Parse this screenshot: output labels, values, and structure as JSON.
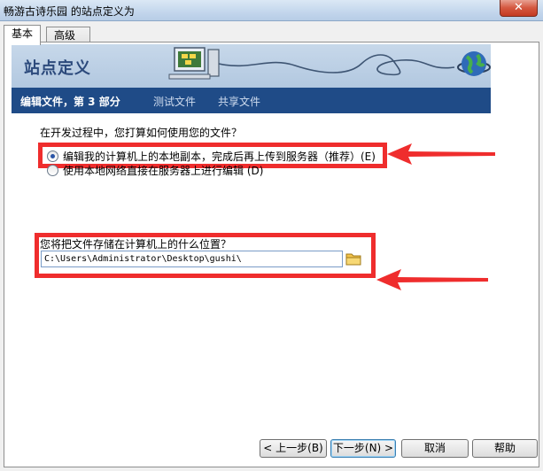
{
  "window": {
    "title": "畅游古诗乐园 的站点定义为",
    "close_label": "✕"
  },
  "tabs": [
    {
      "label": "基本"
    },
    {
      "label": "高级"
    }
  ],
  "banner": {
    "title": "站点定义"
  },
  "wizard_nav": {
    "current": "编辑文件，第 3 部分",
    "test": "测试文件",
    "share": "共享文件"
  },
  "question1": {
    "text": "在开发过程中，您打算如何使用您的文件？",
    "options": [
      {
        "label": "编辑我的计算机上的本地副本，完成后再上传到服务器（推荐）(E)",
        "selected": true
      },
      {
        "label": "使用本地网络直接在服务器上进行编辑 (D)",
        "selected": false
      }
    ]
  },
  "question2": {
    "text": "您将把文件存储在计算机上的什么位置？",
    "path_value": "C:\\Users\\Administrator\\Desktop\\gushi\\"
  },
  "buttons": {
    "back": "< 上一步(B)",
    "next": "下一步(N) >",
    "cancel": "取消",
    "help": "帮助"
  },
  "colors": {
    "highlight": "#ef2d2d",
    "nav_bar": "#1f4b87",
    "banner": "#b2c8e0"
  },
  "icons": [
    "close-icon",
    "computer-icon",
    "network-cable-icon",
    "globe-icon",
    "folder-icon",
    "arrow-icon"
  ]
}
